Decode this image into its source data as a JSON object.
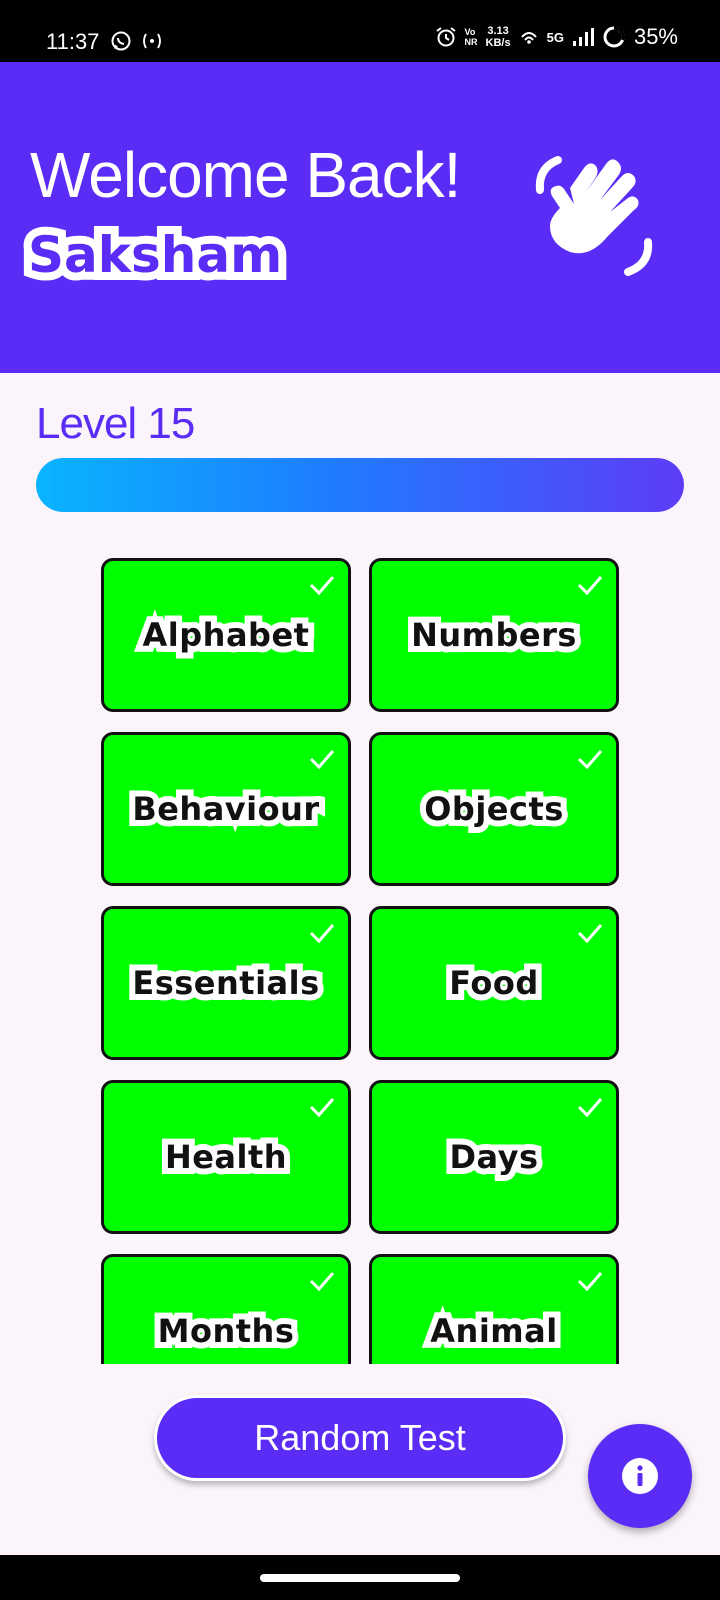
{
  "status_bar": {
    "time": "11:37",
    "net_speed_value": "3.13",
    "net_speed_unit": "KB/s",
    "volte_top": "Vo",
    "volte_bottom": "NR",
    "network": "5G",
    "battery": "35%",
    "icons": [
      "whatsapp-icon",
      "hotspot-icon",
      "alarm-icon",
      "volte-icon",
      "wifi-calling-icon",
      "signal-icon",
      "battery-icon"
    ]
  },
  "header": {
    "greeting": "Welcome Back!",
    "username": "Saksham",
    "icon": "waving-hand-icon"
  },
  "level": {
    "label": "Level 15",
    "progress_fraction": 1.0
  },
  "categories": [
    {
      "label": "Alphabet",
      "completed": true
    },
    {
      "label": "Numbers",
      "completed": true
    },
    {
      "label": "Behaviour",
      "completed": true
    },
    {
      "label": "Objects",
      "completed": true
    },
    {
      "label": "Essentials",
      "completed": true
    },
    {
      "label": "Food",
      "completed": true
    },
    {
      "label": "Health",
      "completed": true
    },
    {
      "label": "Days",
      "completed": true
    },
    {
      "label": "Months",
      "completed": true
    },
    {
      "label": "Animal",
      "completed": true
    }
  ],
  "actions": {
    "random_test_label": "Random Test",
    "info_icon": "info-icon"
  },
  "colors": {
    "primary": "#5a2cf5",
    "tile_green": "#00ff00",
    "background": "#fbf4fb"
  }
}
